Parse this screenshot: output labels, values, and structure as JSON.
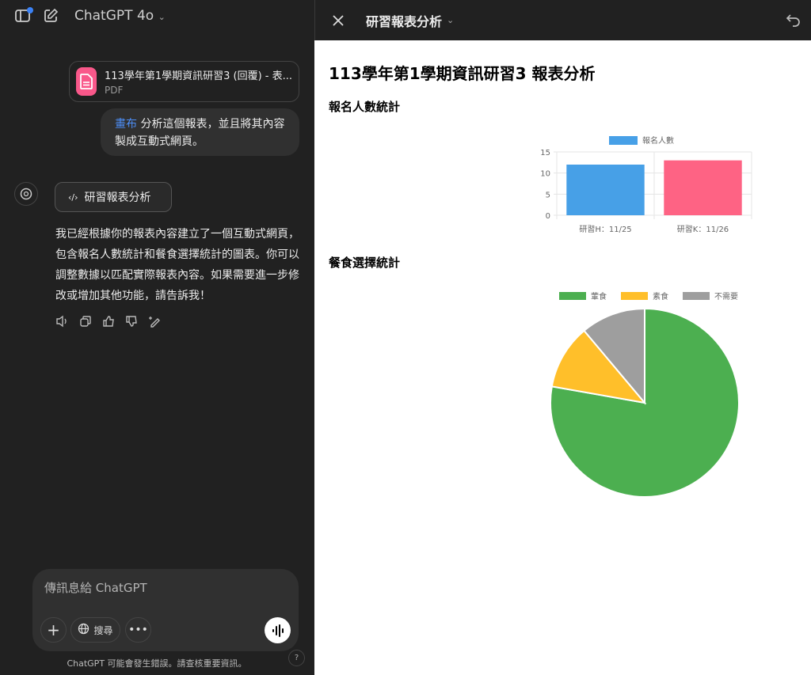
{
  "left": {
    "model": "ChatGPT 4o",
    "file": {
      "name": "113學年第1學期資訊研習3 (回覆) - 表...",
      "type": "PDF"
    },
    "user_message": {
      "mention": "畫布",
      "text": " 分析這個報表，並且將其內容製成互動式網頁。"
    },
    "canvas_button": "研習報表分析",
    "reply": "我已經根據你的報表內容建立了一個互動式網頁，包含報名人數統計和餐食選擇統計的圖表。你可以調整數據以匹配實際報表內容。如果需要進一步修改或增加其他功能，請告訴我！",
    "composer": {
      "placeholder": "傳訊息給 ChatGPT",
      "search": "搜尋"
    },
    "disclaimer": "ChatGPT 可能會發生錯誤。請查核重要資訊。",
    "help": "?"
  },
  "canvas": {
    "title": "研習報表分析",
    "page_title": "113學年第1學期資訊研習3 報表分析",
    "section1": "報名人數統計",
    "section2": "餐食選擇統計"
  },
  "chart_data": [
    {
      "type": "bar",
      "title": "報名人數統計",
      "legend": [
        "報名人數"
      ],
      "categories": [
        "研習H：11/25",
        "研習K：11/26"
      ],
      "values": [
        12,
        13
      ],
      "colors": [
        "#47a0e7",
        "#fe6384"
      ],
      "ylim": [
        0,
        15
      ],
      "yticks": [
        0,
        5,
        10,
        15
      ],
      "legend_position": "top"
    },
    {
      "type": "pie",
      "title": "餐食選擇統計",
      "categories": [
        "葷食",
        "素食",
        "不需要"
      ],
      "values": [
        21,
        3,
        3
      ],
      "colors": [
        "#4caf50",
        "#ffbf2a",
        "#9e9e9e"
      ],
      "legend_position": "top"
    }
  ]
}
